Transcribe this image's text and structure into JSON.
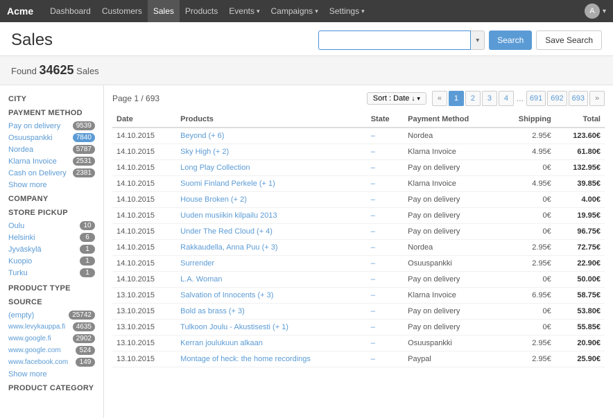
{
  "brand": "Acme",
  "nav": {
    "items": [
      {
        "label": "Dashboard",
        "active": false,
        "hasDropdown": false
      },
      {
        "label": "Customers",
        "active": false,
        "hasDropdown": true
      },
      {
        "label": "Sales",
        "active": true,
        "hasDropdown": false
      },
      {
        "label": "Products",
        "active": false,
        "hasDropdown": false
      },
      {
        "label": "Events",
        "active": false,
        "hasDropdown": true
      },
      {
        "label": "Campaigns",
        "active": false,
        "hasDropdown": true
      },
      {
        "label": "Settings",
        "active": false,
        "hasDropdown": true
      }
    ],
    "avatar_label": "A"
  },
  "page": {
    "title": "Sales",
    "found_prefix": "Found ",
    "found_count": "34625",
    "found_suffix": " Sales"
  },
  "search": {
    "placeholder": "",
    "button_label": "Search",
    "save_label": "Save Search"
  },
  "pagination": {
    "page_info": "Page 1 / 693",
    "sort_label": "Sort : Date",
    "pages": [
      "1",
      "2",
      "3",
      "4",
      "...",
      "691",
      "692",
      "693"
    ],
    "prev": "«",
    "next": "»"
  },
  "filters": {
    "city_title": "CITY",
    "payment_title": "PAYMENT METHOD",
    "payment_items": [
      {
        "label": "Pay on delivery",
        "count": "9539"
      },
      {
        "label": "Osuuspankki",
        "count": "7840"
      },
      {
        "label": "Nordea",
        "count": "5787"
      },
      {
        "label": "Klarna Invoice",
        "count": "2531"
      },
      {
        "label": "Cash on Delivery",
        "count": "2381"
      }
    ],
    "payment_show_more": "Show more",
    "company_title": "COMPANY",
    "store_pickup_title": "STORE PICKUP",
    "store_items": [
      {
        "label": "Oulu",
        "count": "10"
      },
      {
        "label": "Helsinki",
        "count": "6"
      },
      {
        "label": "Jyväskylä",
        "count": "1"
      },
      {
        "label": "Kuopio",
        "count": "1"
      },
      {
        "label": "Turku",
        "count": "1"
      }
    ],
    "product_type_title": "PRODUCT TYPE",
    "source_title": "SOURCE",
    "source_items": [
      {
        "label": "(empty)",
        "count": "25742"
      },
      {
        "label": "www.levykauppa.fi",
        "count": "4635"
      },
      {
        "label": "www.google.fi",
        "count": "2902"
      },
      {
        "label": "www.google.com",
        "count": "524"
      },
      {
        "label": "www.facebook.com",
        "count": "149"
      }
    ],
    "source_show_more": "Show more",
    "product_category_title": "PRODUCT CATEGORY"
  },
  "table": {
    "headers": [
      "Date",
      "Products",
      "State",
      "Payment Method",
      "Shipping",
      "Total"
    ],
    "rows": [
      {
        "date": "14.10.2015",
        "product": "Beyond (+ 6)",
        "state": "–",
        "payment": "Nordea",
        "shipping": "2.95€",
        "total": "123.60€"
      },
      {
        "date": "14.10.2015",
        "product": "Sky High (+ 2)",
        "state": "–",
        "payment": "Klarna Invoice",
        "shipping": "4.95€",
        "total": "61.80€"
      },
      {
        "date": "14.10.2015",
        "product": "Long Play Collection",
        "state": "–",
        "payment": "Pay on delivery",
        "shipping": "0€",
        "total": "132.95€"
      },
      {
        "date": "14.10.2015",
        "product": "Suomi Finland Perkele (+ 1)",
        "state": "–",
        "payment": "Klarna Invoice",
        "shipping": "4.95€",
        "total": "39.85€"
      },
      {
        "date": "14.10.2015",
        "product": "House Broken (+ 2)",
        "state": "–",
        "payment": "Pay on delivery",
        "shipping": "0€",
        "total": "4.00€"
      },
      {
        "date": "14.10.2015",
        "product": "Uuden musiikin kilpailu 2013",
        "state": "–",
        "payment": "Pay on delivery",
        "shipping": "0€",
        "total": "19.95€"
      },
      {
        "date": "14.10.2015",
        "product": "Under The Red Cloud (+ 4)",
        "state": "–",
        "payment": "Pay on delivery",
        "shipping": "0€",
        "total": "96.75€"
      },
      {
        "date": "14.10.2015",
        "product": "Rakkaudella, Anna Puu (+ 3)",
        "state": "–",
        "payment": "Nordea",
        "shipping": "2.95€",
        "total": "72.75€"
      },
      {
        "date": "14.10.2015",
        "product": "Surrender",
        "state": "–",
        "payment": "Osuuspankki",
        "shipping": "2.95€",
        "total": "22.90€"
      },
      {
        "date": "14.10.2015",
        "product": "L.A. Woman",
        "state": "–",
        "payment": "Pay on delivery",
        "shipping": "0€",
        "total": "50.00€"
      },
      {
        "date": "13.10.2015",
        "product": "Salvation of Innocents (+ 3)",
        "state": "–",
        "payment": "Klarna Invoice",
        "shipping": "6.95€",
        "total": "58.75€"
      },
      {
        "date": "13.10.2015",
        "product": "Bold as brass (+ 3)",
        "state": "–",
        "payment": "Pay on delivery",
        "shipping": "0€",
        "total": "53.80€"
      },
      {
        "date": "13.10.2015",
        "product": "Tulkoon Joulu - Akustisesti (+ 1)",
        "state": "–",
        "payment": "Pay on delivery",
        "shipping": "0€",
        "total": "55.85€"
      },
      {
        "date": "13.10.2015",
        "product": "Kerran joulukuun alkaan",
        "state": "–",
        "payment": "Osuuspankki",
        "shipping": "2.95€",
        "total": "20.90€"
      },
      {
        "date": "13.10.2015",
        "product": "Montage of heck: the home recordings",
        "state": "–",
        "payment": "Paypal",
        "shipping": "2.95€",
        "total": "25.90€"
      }
    ]
  }
}
